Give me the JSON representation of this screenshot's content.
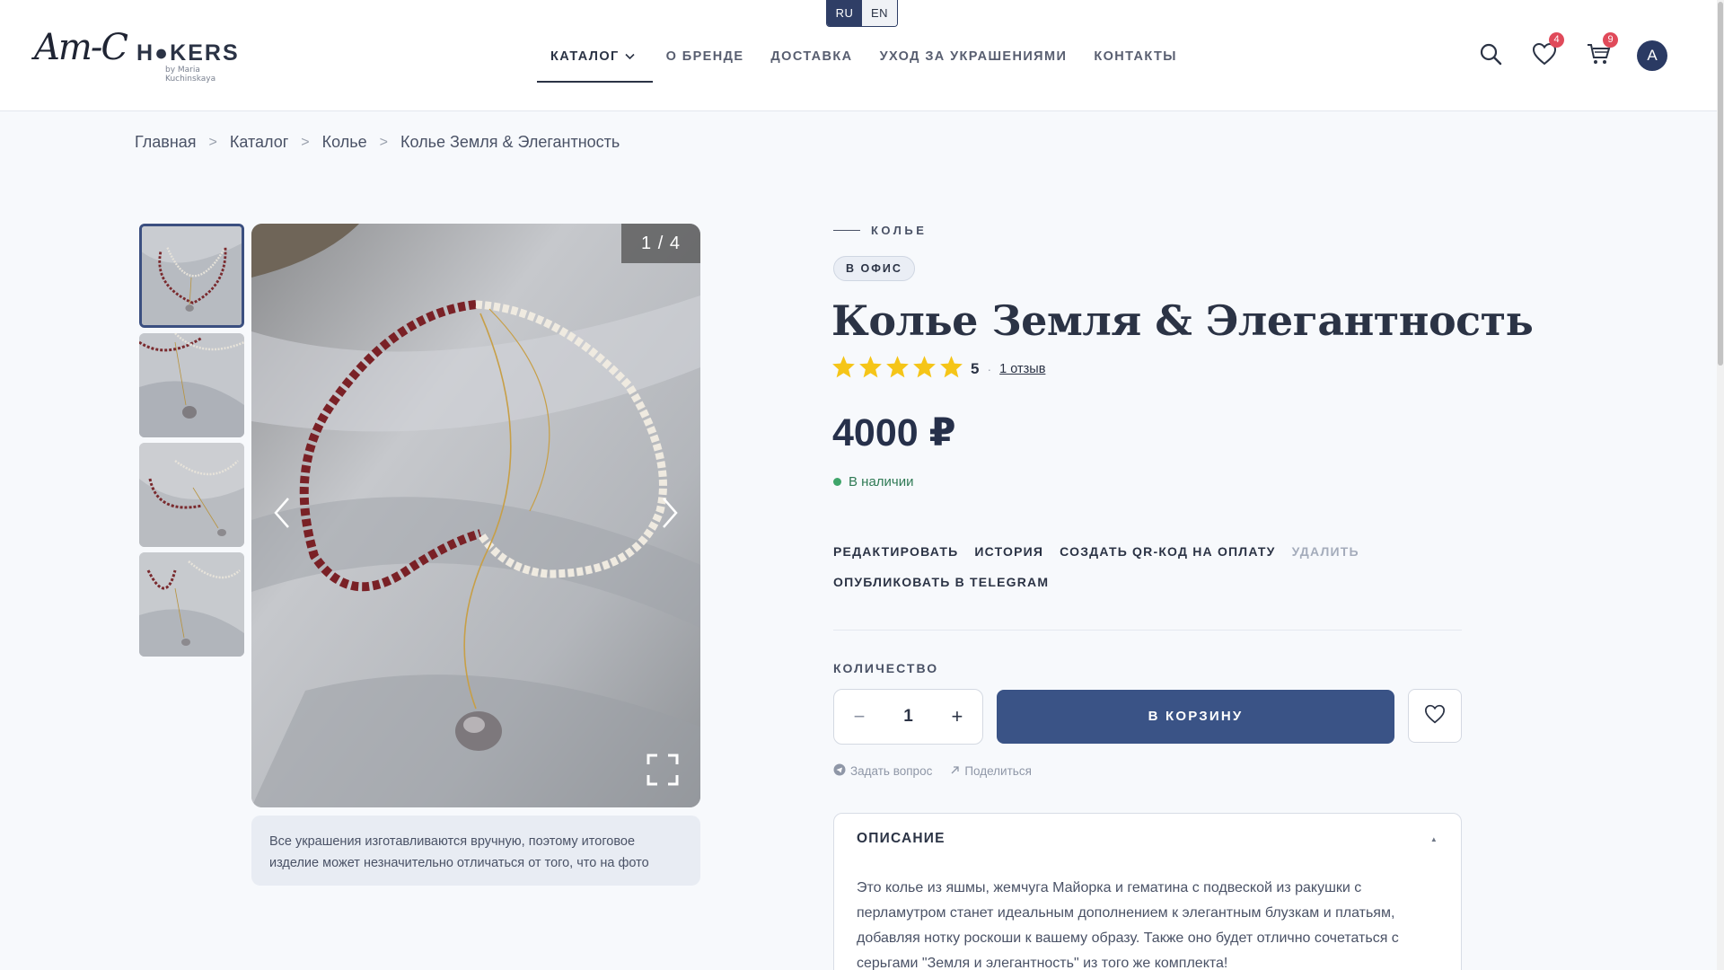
{
  "header": {
    "lang": {
      "ru": "RU",
      "en": "EN"
    },
    "logo": {
      "script": "Am-C",
      "main": "H●KERS",
      "sub": "by Maria Kuchinskaya"
    },
    "nav": {
      "catalog": "КАТАЛОГ",
      "brand": "О БРЕНДЕ",
      "delivery": "ДОСТАВКА",
      "care": "УХОД ЗА УКРАШЕНИЯМИ",
      "contacts": "КОНТАКТЫ"
    },
    "wishlist_count": "4",
    "cart_count": "9",
    "avatar_letter": "A"
  },
  "breadcrumb": {
    "home": "Главная",
    "catalog": "Каталог",
    "category": "Колье",
    "current": "Колье Земля & Элегантность"
  },
  "gallery": {
    "counter": "1 / 4",
    "note": "Все украшения изготавливаются вручную, поэтому итоговое изделие может незначительно отличаться от того, что на фото"
  },
  "product": {
    "category": "КОЛЬЕ",
    "badge": "В ОФИС",
    "title": "Колье Земля & Элегантность",
    "rating": 5,
    "rating_value": "5",
    "reviews_link": "1 отзыв",
    "price": "4000 ₽",
    "stock": "В наличии",
    "actions": {
      "edit": "РЕДАКТИРОВАТЬ",
      "history": "ИСТОРИЯ",
      "qr": "СОЗДАТЬ QR-КОД НА ОПЛАТУ",
      "delete": "УДАЛИТЬ",
      "telegram": "ОПУБЛИКОВАТЬ В TELEGRAM"
    },
    "quantity_label": "КОЛИЧЕСТВО",
    "quantity": "1",
    "minus": "−",
    "plus": "+",
    "add_to_cart": "В КОРЗИНУ",
    "ask": "Задать вопрос",
    "share": "Поделиться",
    "description_title": "ОПИСАНИЕ",
    "description": "Это колье из яшмы, жемчуга Майорка и гематина с подвеской из ракушки с перламутром станет идеальным дополнением к элегантным блузкам и платьям, добавляя нотку роскоши к вашему образу. Также оно будет отлично сочетаться с серьгами \"Земля и элегантность\" из того же комплекта!"
  },
  "colors": {
    "primary": "#3a5386",
    "star": "#f5c518",
    "in_stock": "#3fa56a",
    "badge": "#e04a5a"
  }
}
